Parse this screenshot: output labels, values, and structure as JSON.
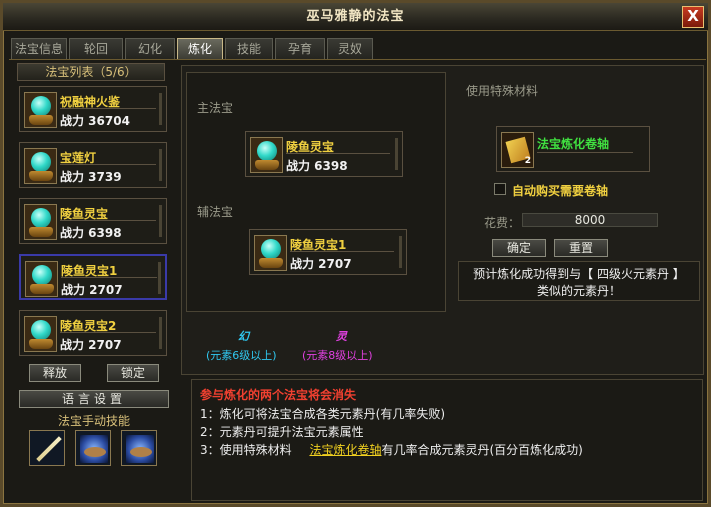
{
  "window": {
    "title": "巫马雅静的法宝",
    "close": "X"
  },
  "tabs": [
    {
      "label": "法宝信息"
    },
    {
      "label": "轮回"
    },
    {
      "label": "幻化"
    },
    {
      "label": "炼化",
      "active": true
    },
    {
      "label": "技能"
    },
    {
      "label": "孕育"
    },
    {
      "label": "灵奴"
    }
  ],
  "sidebar": {
    "list_title": "法宝列表（5/6）",
    "items": [
      {
        "name": "祝融神火鉴",
        "power": "战力 36704"
      },
      {
        "name": "宝莲灯",
        "power": "战力 3739"
      },
      {
        "name": "陵鱼灵宝",
        "power": "战力 6398"
      },
      {
        "name": "陵鱼灵宝1",
        "power": "战力 2707",
        "selected": true
      },
      {
        "name": "陵鱼灵宝2",
        "power": "战力 2707"
      }
    ],
    "release_label": "释放",
    "lock_label": "锁定",
    "language_label": "语言设置",
    "skills_title": "法宝手动技能"
  },
  "refine": {
    "main_label": "主法宝",
    "main_item": {
      "name": "陵鱼灵宝",
      "power": "战力 6398"
    },
    "aux_label": "辅法宝",
    "aux_item": {
      "name": "陵鱼灵宝1",
      "power": "战力 2707"
    },
    "illusion_glyph": "幻",
    "illusion_text": "(元素6级以上)",
    "spirit_glyph": "灵",
    "spirit_text": "(元素8级以上)"
  },
  "material": {
    "title": "使用特殊材料",
    "item_name": "法宝炼化卷轴",
    "item_count": "2",
    "auto_buy": "自动购买需要卷轴",
    "cost_label": "花费：",
    "cost_value": "8000",
    "confirm_label": "确定",
    "reset_label": "重置",
    "predict_line1": "预计炼化成功得到与【 四级火元素丹 】",
    "predict_line2": "类似的元素丹！"
  },
  "info": {
    "warning": "参与炼化的两个法宝将会消失",
    "line1": "1：炼化可将法宝合成各类元素丹(有几率失败)",
    "line2": "2：元素丹可提升法宝元素属性",
    "line3_prefix": "3：使用特殊材料",
    "line3_link": "法宝炼化卷轴",
    "line3_suffix": "有几率合成元素灵丹(百分百炼化成功)"
  },
  "colors": {
    "gold": "#f0d040",
    "illusion": "#30c8f0",
    "spirit": "#e040e0",
    "warning": "#f04030"
  }
}
